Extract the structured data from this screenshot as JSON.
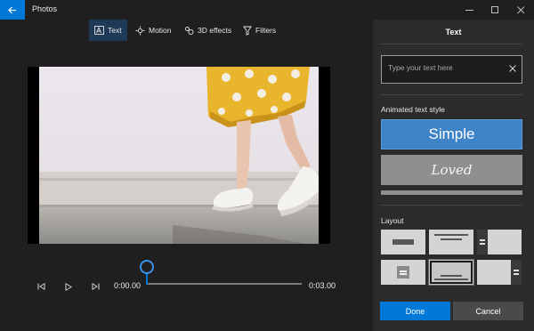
{
  "window": {
    "title": "Photos",
    "controls": [
      "minimize-icon",
      "maximize-icon",
      "close-icon"
    ]
  },
  "toolbar": {
    "items": [
      {
        "label": "Text",
        "icon": "text-icon",
        "active": true
      },
      {
        "label": "Motion",
        "icon": "motion-icon",
        "active": false
      },
      {
        "label": "3D effects",
        "icon": "3d-effects-icon",
        "active": false
      },
      {
        "label": "Filters",
        "icon": "filters-icon",
        "active": false
      }
    ]
  },
  "playback": {
    "current_time": "0:00.00",
    "total_time": "0:03.00",
    "progress": 0,
    "controls": [
      "previous-frame-icon",
      "play-icon",
      "next-frame-icon"
    ]
  },
  "text_panel": {
    "title": "Text",
    "input_placeholder": "Type your text here",
    "input_value": "",
    "animated_style_label": "Animated text style",
    "styles": [
      {
        "label": "Simple",
        "selected": true
      },
      {
        "label": "Loved",
        "selected": false
      }
    ],
    "layout_label": "Layout",
    "selected_layout_index": 4,
    "done_label": "Done",
    "cancel_label": "Cancel"
  },
  "colors": {
    "accent": "#0078d7",
    "background": "#1f1f1f",
    "panel": "#2b2b2b",
    "selected_style": "#3f83c8"
  }
}
